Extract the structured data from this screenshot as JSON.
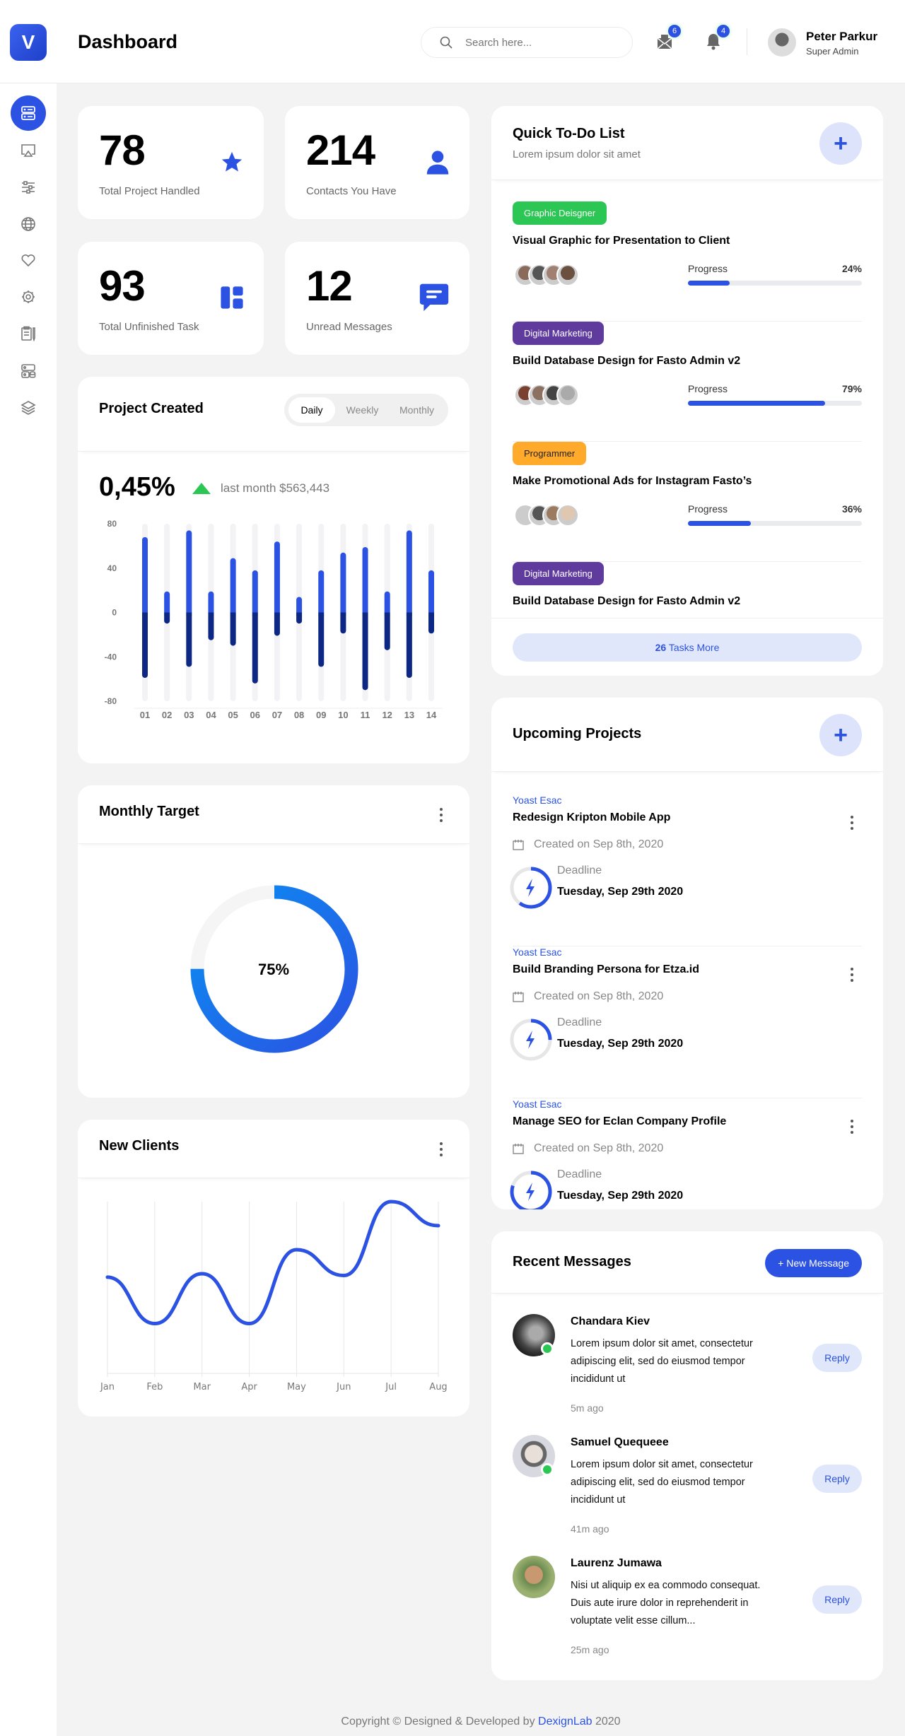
{
  "header": {
    "logo_letter": "V",
    "title": "Dashboard",
    "search_placeholder": "Search here...",
    "mail_badge": "6",
    "bell_badge": "4",
    "user_name": "Peter Parkur",
    "user_role": "Super Admin"
  },
  "sidebar": {
    "items": [
      {
        "icon": "dashboard-icon",
        "active": true
      },
      {
        "icon": "airplay-icon"
      },
      {
        "icon": "sliders-icon"
      },
      {
        "icon": "globe-icon"
      },
      {
        "icon": "heart-icon"
      },
      {
        "icon": "settings-icon"
      },
      {
        "icon": "clipboard-icon"
      },
      {
        "icon": "database-icon"
      },
      {
        "icon": "layers-icon"
      }
    ]
  },
  "stats": [
    {
      "value": "78",
      "label": "Total Project Handled",
      "icon": "star-icon"
    },
    {
      "value": "214",
      "label": "Contacts You Have",
      "icon": "user-icon"
    },
    {
      "value": "93",
      "label": "Total Unfinished Task",
      "icon": "widgets-icon"
    },
    {
      "value": "12",
      "label": "Unread Messages",
      "icon": "chat-icon"
    }
  ],
  "project_created": {
    "title": "Project Created",
    "tabs": [
      "Daily",
      "Weekly",
      "Monthly"
    ],
    "active_tab": "Daily",
    "change": "0,45%",
    "change_note": "last month $563,443",
    "trend": "up",
    "trend_color": "#2cc654"
  },
  "chart_data": [
    {
      "type": "bar",
      "categories": [
        "01",
        "02",
        "03",
        "04",
        "05",
        "06",
        "07",
        "08",
        "09",
        "10",
        "11",
        "12",
        "13",
        "14"
      ],
      "series": [
        {
          "values": [
            68,
            19,
            74,
            19,
            49,
            38,
            64,
            14,
            38,
            54,
            59,
            19,
            74,
            38
          ],
          "color": "#2b52e3"
        },
        {
          "values": [
            -59,
            -10,
            -49,
            -25,
            -30,
            -64,
            -21,
            -10,
            -49,
            -19,
            -70,
            -34,
            -59,
            -19
          ],
          "color": "#0c2784"
        }
      ],
      "yticks": [
        "80",
        "40",
        "0",
        "-40",
        "-80"
      ],
      "ylim": [
        -80,
        80
      ],
      "stacked": true
    },
    {
      "type": "line",
      "categories": [
        "Jan",
        "Feb",
        "Mar",
        "Apr",
        "May",
        "Jun",
        "Jul",
        "Aug"
      ],
      "series": [
        {
          "values": [
            56,
            29,
            58,
            29,
            72,
            57,
            100,
            86
          ],
          "color": "#2b52e3"
        }
      ],
      "grid": "vertical",
      "ylim": [
        0,
        100
      ]
    }
  ],
  "monthly_target": {
    "title": "Monthly Target",
    "value_label": "75%",
    "fraction": 0.75
  },
  "new_clients": {
    "title": "New Clients"
  },
  "todo": {
    "title": "Quick To-Do List",
    "subtitle": "Lorem ipsum dolor sit amet",
    "progress_label": "Progress",
    "items": [
      {
        "tag": "Graphic Deisgner",
        "tag_color": "#2cc654",
        "title": "Visual Graphic for Presentation to Client",
        "progress": "24%",
        "progress_value": 24
      },
      {
        "tag": "Digital Marketing",
        "tag_color": "#5f3b9e",
        "title": "Build Database Design for Fasto Admin v2",
        "progress": "79%",
        "progress_value": 79
      },
      {
        "tag": "Programmer",
        "tag_color": "#ffaa2b",
        "title": "Make Promotional Ads for Instagram Fasto’s",
        "progress": "36%",
        "progress_value": 36
      },
      {
        "tag": "Digital Marketing",
        "tag_color": "#5f3b9e",
        "title": "Build Database Design for Fasto Admin v2"
      }
    ],
    "more_count": "26",
    "more_label": "Tasks More"
  },
  "upcoming": {
    "title": "Upcoming Projects",
    "deadline_label": "Deadline",
    "items": [
      {
        "author": "Yoast Esac",
        "title": "Redesign Kripton Mobile App",
        "created": "Created on Sep 8th, 2020",
        "deadline": "Tuesday, Sep 29th 2020",
        "progress": 0.6
      },
      {
        "author": "Yoast Esac",
        "title": "Build Branding Persona for Etza.id",
        "created": "Created on Sep 8th, 2020",
        "deadline": "Tuesday, Sep 29th 2020",
        "progress": 0.25
      },
      {
        "author": "Yoast Esac",
        "title": "Manage SEO for Eclan Company Profile",
        "created": "Created on Sep 8th, 2020",
        "deadline": "Tuesday, Sep 29th 2020",
        "progress": 0.8
      }
    ]
  },
  "messages": {
    "title": "Recent Messages",
    "new_label": "+ New Message",
    "reply_label": "Reply",
    "items": [
      {
        "name": "Chandara Kiev",
        "text": "Lorem ipsum dolor sit amet, consectetur adipiscing elit, sed do eiusmod tempor incididunt ut",
        "time": "5m ago",
        "online": true
      },
      {
        "name": "Samuel Quequeee",
        "text": "Lorem ipsum dolor sit amet, consectetur adipiscing elit, sed do eiusmod tempor incididunt ut",
        "time": "41m ago",
        "online": true
      },
      {
        "name": "Laurenz Jumawa",
        "text": "Nisi ut aliquip ex ea commodo consequat. Duis aute irure dolor in reprehenderit in voluptate velit esse cillum...",
        "time": "25m ago",
        "online": false
      }
    ]
  },
  "footer": {
    "text": "Copyright © Designed & Developed by",
    "link": "DexignLab",
    "year": "2020"
  }
}
